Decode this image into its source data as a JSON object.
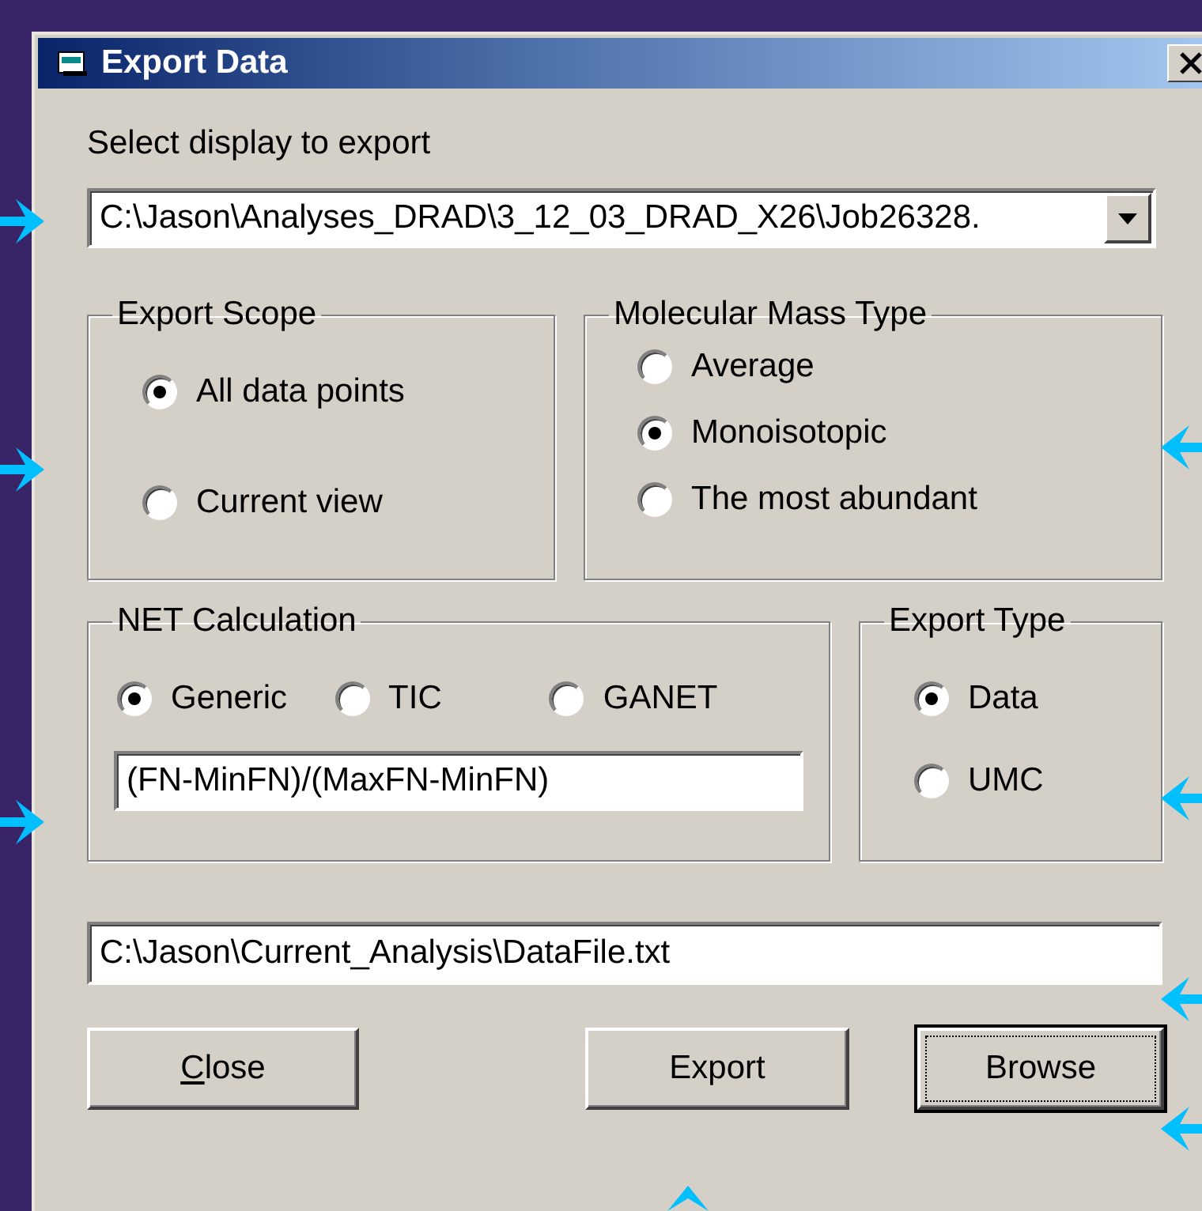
{
  "window": {
    "title": "Export Data"
  },
  "display_label": "Select display to export",
  "display_combo": {
    "value": "C:\\Jason\\Analyses_DRAD\\3_12_03_DRAD_X26\\Job26328."
  },
  "export_scope": {
    "title": "Export Scope",
    "options": [
      {
        "label": "All data points",
        "selected": true
      },
      {
        "label": "Current view",
        "selected": false
      }
    ]
  },
  "molecular_mass_type": {
    "title": "Molecular Mass Type",
    "options": [
      {
        "label": "Average",
        "selected": false
      },
      {
        "label": "Monoisotopic",
        "selected": true
      },
      {
        "label": "The most abundant",
        "selected": false
      }
    ]
  },
  "net_calculation": {
    "title": "NET Calculation",
    "options": [
      {
        "label": "Generic",
        "selected": true
      },
      {
        "label": "TIC",
        "selected": false
      },
      {
        "label": "GANET",
        "selected": false
      }
    ],
    "formula": "(FN-MinFN)/(MaxFN-MinFN)"
  },
  "export_type": {
    "title": "Export Type",
    "options": [
      {
        "label": "Data",
        "selected": true
      },
      {
        "label": "UMC",
        "selected": false
      }
    ]
  },
  "output_path": "C:\\Jason\\Current_Analysis\\DataFile.txt",
  "buttons": [
    {
      "label": "Close",
      "first_letter_underlined": true,
      "focused": false
    },
    {
      "label": "Export",
      "first_letter_underlined": false,
      "focused": false
    },
    {
      "label": "Browse",
      "first_letter_underlined": false,
      "focused": true
    }
  ]
}
